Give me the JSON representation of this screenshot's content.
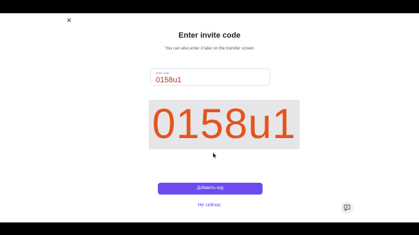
{
  "dialog": {
    "close_glyph": "×",
    "title": "Enter invite code",
    "subtitle": "You can also enter it later on the transfer screen"
  },
  "invite_input": {
    "label": "Invite code",
    "value": "0158u1"
  },
  "zoom_overlay": {
    "code": "0158u1"
  },
  "actions": {
    "primary_label": "Добавить код",
    "secondary_label": "Не сейчас"
  },
  "icons": {
    "close": "close-icon",
    "chat": "chat-icon",
    "cursor": "mouse-pointer-icon"
  },
  "colors": {
    "accent": "#6c4cf1",
    "code_overlay": "#e6521c",
    "input_value": "#b0331b"
  }
}
